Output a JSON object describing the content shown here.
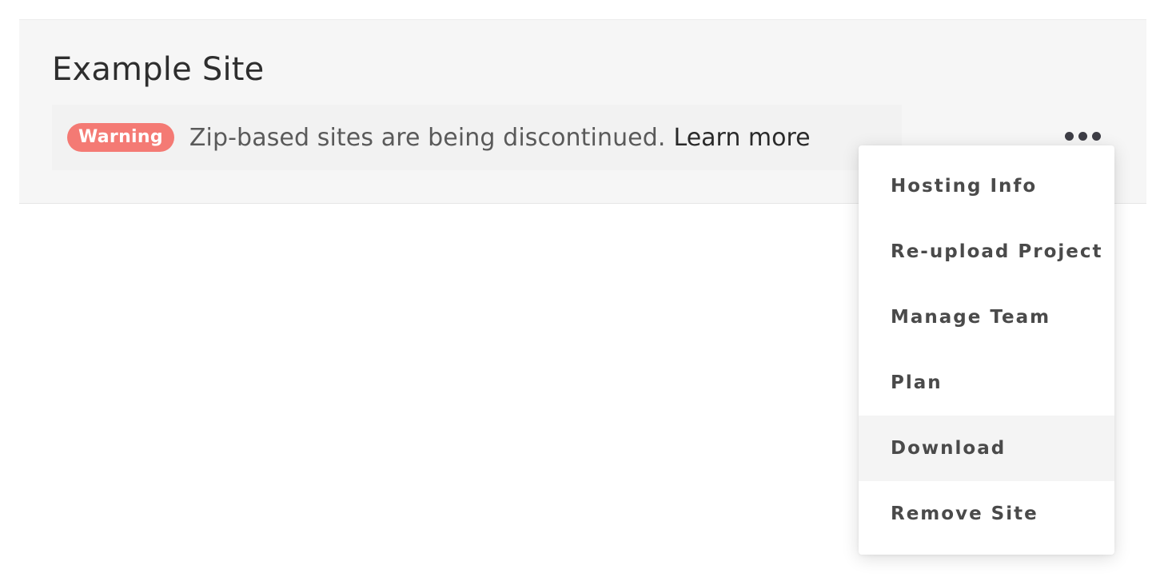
{
  "site": {
    "title": "Example Site"
  },
  "notice": {
    "badge": "Warning",
    "message": "Zip-based sites are being discontinued.",
    "link_label": "Learn more",
    "badge_color": "#f47a74"
  },
  "more_button": {
    "icon": "more-horizontal-icon"
  },
  "menu": {
    "items": [
      {
        "label": "Hosting Info"
      },
      {
        "label": "Re-upload Project"
      },
      {
        "label": "Manage Team"
      },
      {
        "label": "Plan"
      },
      {
        "label": "Download"
      },
      {
        "label": "Remove Site"
      }
    ],
    "highlighted_item": "Download"
  }
}
